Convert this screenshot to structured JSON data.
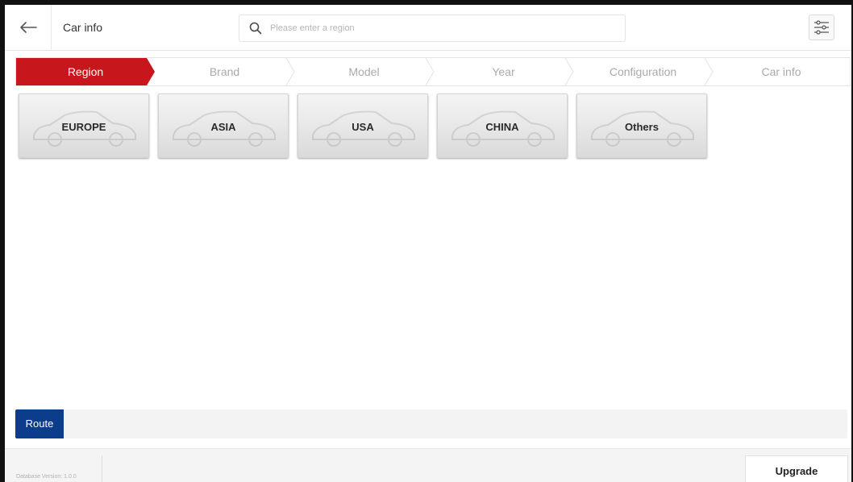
{
  "header": {
    "title": "Car info",
    "search": {
      "placeholder": "Please enter a region",
      "value": ""
    },
    "back_icon": "arrow-left-icon",
    "filter_icon": "sliders-icon"
  },
  "steps": [
    {
      "label": "Region",
      "active": true
    },
    {
      "label": "Brand",
      "active": false
    },
    {
      "label": "Model",
      "active": false
    },
    {
      "label": "Year",
      "active": false
    },
    {
      "label": "Configuration",
      "active": false
    },
    {
      "label": "Car info",
      "active": false
    }
  ],
  "regions": [
    "EUROPE",
    "ASIA",
    "USA",
    "CHINA",
    "Others"
  ],
  "route": {
    "label": "Route"
  },
  "footer": {
    "database_version": "Database Version: 1.0.0",
    "upgrade_label": "Upgrade"
  },
  "colors": {
    "active_step": "#c8161d",
    "route_button": "#0b3d8c",
    "step_inactive_text": "#aaaaaa"
  }
}
